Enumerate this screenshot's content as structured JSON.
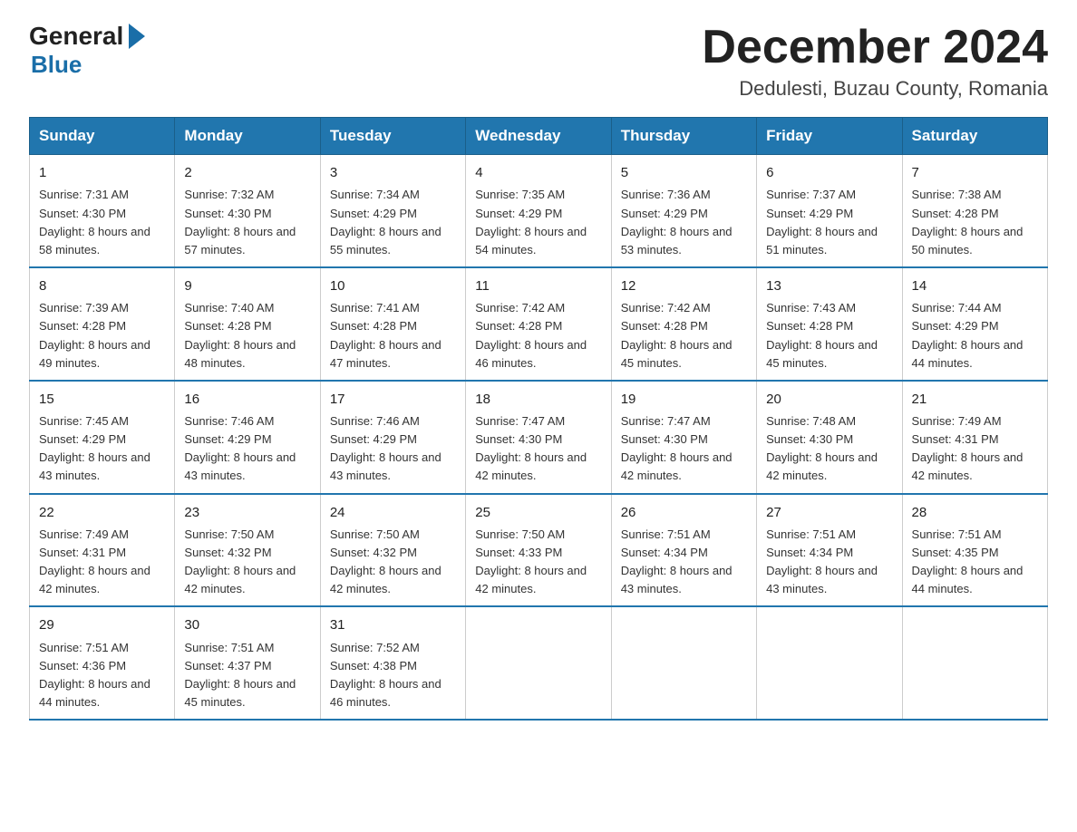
{
  "header": {
    "logo_general": "General",
    "logo_blue": "Blue",
    "month_title": "December 2024",
    "subtitle": "Dedulesti, Buzau County, Romania"
  },
  "days_of_week": [
    "Sunday",
    "Monday",
    "Tuesday",
    "Wednesday",
    "Thursday",
    "Friday",
    "Saturday"
  ],
  "weeks": [
    [
      {
        "day": "1",
        "sunrise": "7:31 AM",
        "sunset": "4:30 PM",
        "daylight": "8 hours and 58 minutes."
      },
      {
        "day": "2",
        "sunrise": "7:32 AM",
        "sunset": "4:30 PM",
        "daylight": "8 hours and 57 minutes."
      },
      {
        "day": "3",
        "sunrise": "7:34 AM",
        "sunset": "4:29 PM",
        "daylight": "8 hours and 55 minutes."
      },
      {
        "day": "4",
        "sunrise": "7:35 AM",
        "sunset": "4:29 PM",
        "daylight": "8 hours and 54 minutes."
      },
      {
        "day": "5",
        "sunrise": "7:36 AM",
        "sunset": "4:29 PM",
        "daylight": "8 hours and 53 minutes."
      },
      {
        "day": "6",
        "sunrise": "7:37 AM",
        "sunset": "4:29 PM",
        "daylight": "8 hours and 51 minutes."
      },
      {
        "day": "7",
        "sunrise": "7:38 AM",
        "sunset": "4:28 PM",
        "daylight": "8 hours and 50 minutes."
      }
    ],
    [
      {
        "day": "8",
        "sunrise": "7:39 AM",
        "sunset": "4:28 PM",
        "daylight": "8 hours and 49 minutes."
      },
      {
        "day": "9",
        "sunrise": "7:40 AM",
        "sunset": "4:28 PM",
        "daylight": "8 hours and 48 minutes."
      },
      {
        "day": "10",
        "sunrise": "7:41 AM",
        "sunset": "4:28 PM",
        "daylight": "8 hours and 47 minutes."
      },
      {
        "day": "11",
        "sunrise": "7:42 AM",
        "sunset": "4:28 PM",
        "daylight": "8 hours and 46 minutes."
      },
      {
        "day": "12",
        "sunrise": "7:42 AM",
        "sunset": "4:28 PM",
        "daylight": "8 hours and 45 minutes."
      },
      {
        "day": "13",
        "sunrise": "7:43 AM",
        "sunset": "4:28 PM",
        "daylight": "8 hours and 45 minutes."
      },
      {
        "day": "14",
        "sunrise": "7:44 AM",
        "sunset": "4:29 PM",
        "daylight": "8 hours and 44 minutes."
      }
    ],
    [
      {
        "day": "15",
        "sunrise": "7:45 AM",
        "sunset": "4:29 PM",
        "daylight": "8 hours and 43 minutes."
      },
      {
        "day": "16",
        "sunrise": "7:46 AM",
        "sunset": "4:29 PM",
        "daylight": "8 hours and 43 minutes."
      },
      {
        "day": "17",
        "sunrise": "7:46 AM",
        "sunset": "4:29 PM",
        "daylight": "8 hours and 43 minutes."
      },
      {
        "day": "18",
        "sunrise": "7:47 AM",
        "sunset": "4:30 PM",
        "daylight": "8 hours and 42 minutes."
      },
      {
        "day": "19",
        "sunrise": "7:47 AM",
        "sunset": "4:30 PM",
        "daylight": "8 hours and 42 minutes."
      },
      {
        "day": "20",
        "sunrise": "7:48 AM",
        "sunset": "4:30 PM",
        "daylight": "8 hours and 42 minutes."
      },
      {
        "day": "21",
        "sunrise": "7:49 AM",
        "sunset": "4:31 PM",
        "daylight": "8 hours and 42 minutes."
      }
    ],
    [
      {
        "day": "22",
        "sunrise": "7:49 AM",
        "sunset": "4:31 PM",
        "daylight": "8 hours and 42 minutes."
      },
      {
        "day": "23",
        "sunrise": "7:50 AM",
        "sunset": "4:32 PM",
        "daylight": "8 hours and 42 minutes."
      },
      {
        "day": "24",
        "sunrise": "7:50 AM",
        "sunset": "4:32 PM",
        "daylight": "8 hours and 42 minutes."
      },
      {
        "day": "25",
        "sunrise": "7:50 AM",
        "sunset": "4:33 PM",
        "daylight": "8 hours and 42 minutes."
      },
      {
        "day": "26",
        "sunrise": "7:51 AM",
        "sunset": "4:34 PM",
        "daylight": "8 hours and 43 minutes."
      },
      {
        "day": "27",
        "sunrise": "7:51 AM",
        "sunset": "4:34 PM",
        "daylight": "8 hours and 43 minutes."
      },
      {
        "day": "28",
        "sunrise": "7:51 AM",
        "sunset": "4:35 PM",
        "daylight": "8 hours and 44 minutes."
      }
    ],
    [
      {
        "day": "29",
        "sunrise": "7:51 AM",
        "sunset": "4:36 PM",
        "daylight": "8 hours and 44 minutes."
      },
      {
        "day": "30",
        "sunrise": "7:51 AM",
        "sunset": "4:37 PM",
        "daylight": "8 hours and 45 minutes."
      },
      {
        "day": "31",
        "sunrise": "7:52 AM",
        "sunset": "4:38 PM",
        "daylight": "8 hours and 46 minutes."
      },
      null,
      null,
      null,
      null
    ]
  ]
}
